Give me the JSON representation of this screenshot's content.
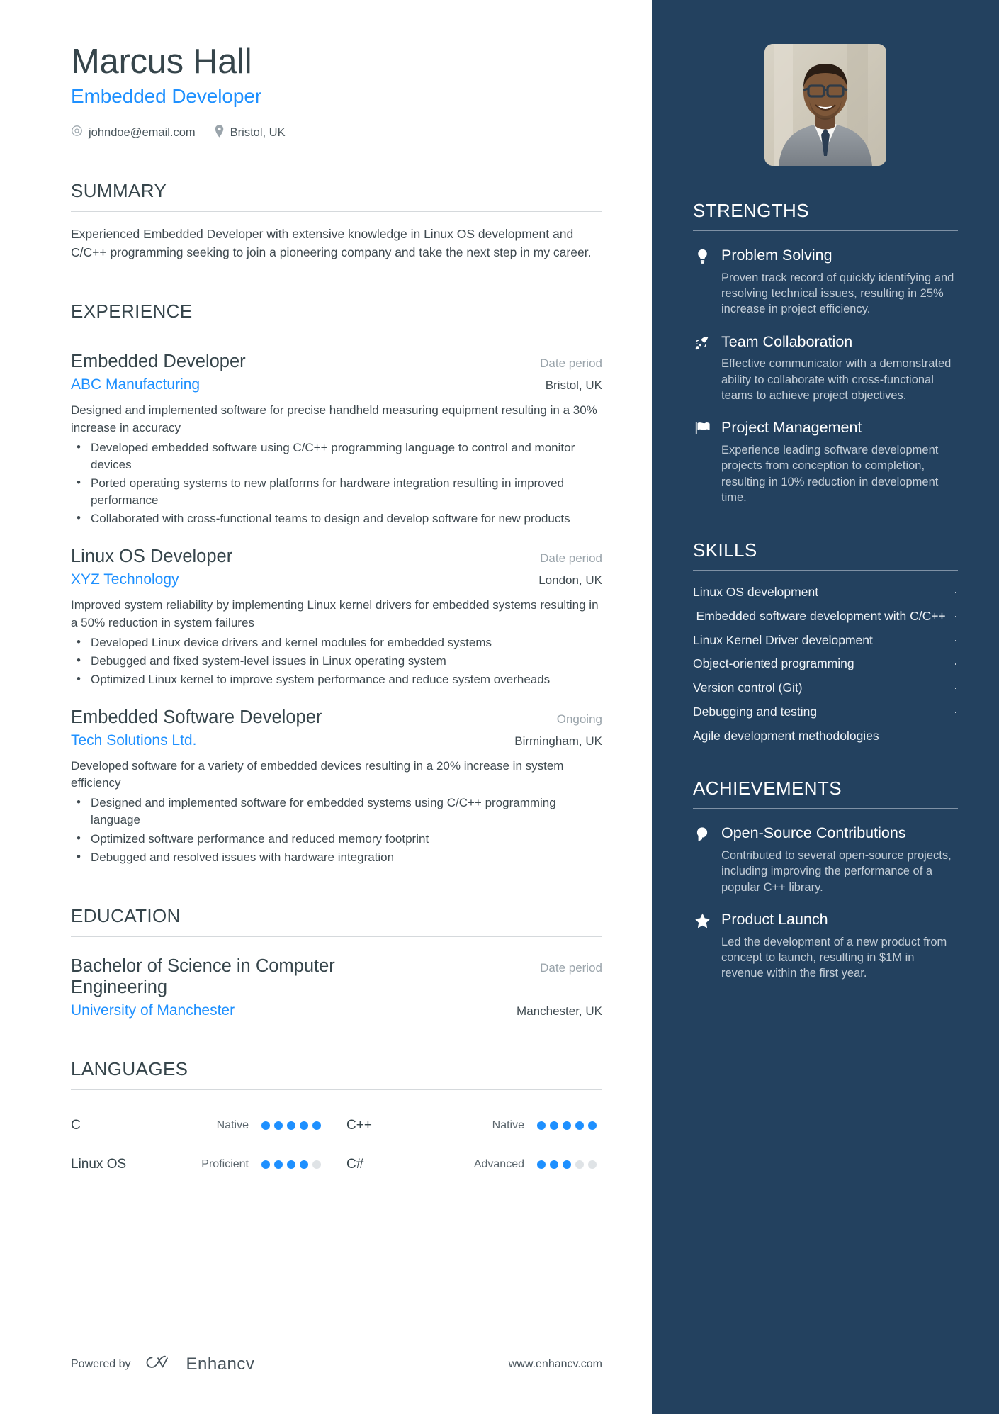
{
  "header": {
    "name": "Marcus Hall",
    "job_title": "Embedded Developer",
    "email": "johndoe@email.com",
    "location": "Bristol, UK",
    "email_icon": "at-sign-icon",
    "location_icon": "map-pin-icon"
  },
  "summary": {
    "title": "SUMMARY",
    "text": "Experienced Embedded Developer with extensive knowledge in Linux OS development and C/C++ programming seeking to join a pioneering company and take the next step in my career."
  },
  "experience": {
    "title": "EXPERIENCE",
    "entries": [
      {
        "role": "Embedded Developer",
        "date": "Date period",
        "company": "ABC Manufacturing",
        "location": "Bristol, UK",
        "description": "Designed and implemented software for precise handheld measuring equipment resulting in a 30% increase in accuracy",
        "bullets": [
          "Developed embedded software using C/C++ programming language to control and monitor devices",
          "Ported operating systems to new platforms for hardware integration resulting in improved performance",
          "Collaborated with cross-functional teams to design and develop software for new products"
        ]
      },
      {
        "role": "Linux OS Developer",
        "date": "Date period",
        "company": "XYZ Technology",
        "location": "London, UK",
        "description": "Improved system reliability by implementing Linux kernel drivers for embedded systems resulting in a 50% reduction in system failures",
        "bullets": [
          "Developed Linux device drivers and kernel modules for embedded systems",
          "Debugged and fixed system-level issues in Linux operating system",
          "Optimized Linux kernel to improve system performance and reduce system overheads"
        ]
      },
      {
        "role": "Embedded Software Developer",
        "date": "Ongoing",
        "company": "Tech Solutions Ltd.",
        "location": "Birmingham, UK",
        "description": "Developed software for a variety of embedded devices resulting in a 20% increase in system efficiency",
        "bullets": [
          "Designed and implemented software for embedded systems using C/C++ programming language",
          "Optimized software performance and reduced memory footprint",
          "Debugged and resolved issues with hardware integration"
        ]
      }
    ]
  },
  "education": {
    "title": "EDUCATION",
    "entries": [
      {
        "degree": "Bachelor of Science in Computer Engineering",
        "date": "Date period",
        "school": "University of Manchester",
        "location": "Manchester, UK"
      }
    ]
  },
  "languages": {
    "title": "LANGUAGES",
    "items": [
      {
        "name": "C",
        "level": "Native",
        "filled": 5,
        "total": 5
      },
      {
        "name": "C++",
        "level": "Native",
        "filled": 5,
        "total": 5
      },
      {
        "name": "Linux OS",
        "level": "Proficient",
        "filled": 4,
        "total": 5
      },
      {
        "name": "C#",
        "level": "Advanced",
        "filled": 3,
        "total": 5
      }
    ]
  },
  "footer": {
    "powered_by": "Powered by",
    "brand": "Enhancv",
    "url": "www.enhancv.com",
    "logo_icon": "enhancv-logo-icon"
  },
  "sidebar": {
    "photo_alt": "profile-photo",
    "strengths": {
      "title": "STRENGTHS",
      "items": [
        {
          "icon": "lightbulb-icon",
          "name": "Problem Solving",
          "desc": "Proven track record of quickly identifying and resolving technical issues, resulting in 25% increase in project efficiency."
        },
        {
          "icon": "rocket-icon",
          "name": "Team Collaboration",
          "desc": "Effective communicator with a demonstrated ability to collaborate with cross-functional teams to achieve project objectives."
        },
        {
          "icon": "flag-icon",
          "name": "Project Management",
          "desc": "Experience leading software development projects from conception to completion, resulting in 10% reduction in development time."
        }
      ]
    },
    "skills": {
      "title": "SKILLS",
      "separator": "·",
      "items": [
        {
          "text": "Linux OS development",
          "sep": "·",
          "wrap": false
        },
        {
          "text": "Embedded software development with C/C++",
          "sep": "·",
          "wrap": true
        },
        {
          "text": "Linux Kernel Driver development",
          "sep": "·",
          "wrap": false
        },
        {
          "text": "Object-oriented programming",
          "sep": "·",
          "wrap": false
        },
        {
          "text": "Version control (Git)",
          "sep": "·",
          "wrap": false
        },
        {
          "text": "Debugging and testing",
          "sep": "·",
          "wrap": false
        },
        {
          "text": "Agile development methodologies",
          "sep": "",
          "wrap": false
        }
      ]
    },
    "achievements": {
      "title": "ACHIEVEMENTS",
      "items": [
        {
          "icon": "award-badge-icon",
          "name": "Open-Source Contributions",
          "desc": "Contributed to several open-source projects, including improving the performance of a popular C++ library."
        },
        {
          "icon": "star-icon",
          "name": "Product Launch",
          "desc": "Led the development of a new product from concept to launch, resulting in $1M in revenue within the first year."
        }
      ]
    }
  },
  "colors": {
    "accent_blue": "#1e90ff",
    "sidebar_bg": "#23415f",
    "heading": "#36454b",
    "body_text": "#3f4a50",
    "muted": "#9aa4ab",
    "sidebar_muted": "#c2ccd6"
  }
}
